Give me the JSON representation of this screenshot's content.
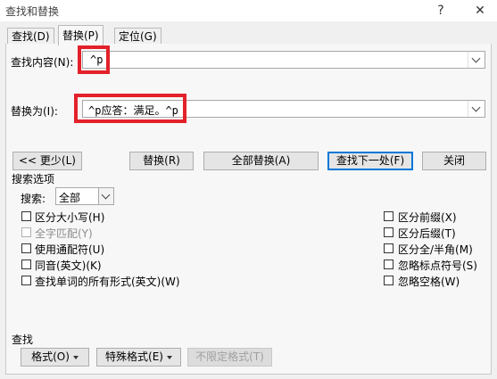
{
  "window": {
    "title": "查找和替换",
    "help": "?",
    "close": "✕"
  },
  "tabs": [
    {
      "label": "查找(D)"
    },
    {
      "label": "替换(P)"
    },
    {
      "label": "定位(G)"
    }
  ],
  "find": {
    "label": "查找内容(N):",
    "value": "^p"
  },
  "replace": {
    "label": "替换为(I):",
    "value": "^p应答：满足。^p"
  },
  "buttons": {
    "less": "<< 更少(L)",
    "replace": "替换(R)",
    "replace_all": "全部替换(A)",
    "find_next": "查找下一处(F)",
    "close": "关闭"
  },
  "options": {
    "title": "搜索选项",
    "search_label": "搜索:",
    "search_value": "全部",
    "left": [
      {
        "label": "区分大小写(H)",
        "enabled": true
      },
      {
        "label": "全字匹配(Y)",
        "enabled": false
      },
      {
        "label": "使用通配符(U)",
        "enabled": true
      },
      {
        "label": "同音(英文)(K)",
        "enabled": true
      },
      {
        "label": "查找单词的所有形式(英文)(W)",
        "enabled": true
      }
    ],
    "right": [
      {
        "label": "区分前缀(X)"
      },
      {
        "label": "区分后缀(T)"
      },
      {
        "label": "区分全/半角(M)"
      },
      {
        "label": "忽略标点符号(S)"
      },
      {
        "label": "忽略空格(W)"
      }
    ]
  },
  "bottom": {
    "title": "查找",
    "format": "格式(O)",
    "special": "特殊格式(E)",
    "no_format": "不限定格式(T)"
  }
}
